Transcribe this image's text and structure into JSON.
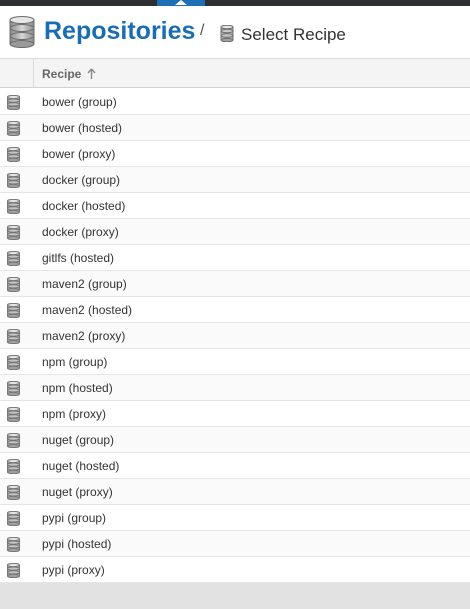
{
  "header": {
    "title": "Repositories",
    "separator": "/",
    "subtitle": "Select Recipe"
  },
  "grid": {
    "column_recipe": "Recipe",
    "sort": "ascending",
    "rows": [
      {
        "label": "bower (group)"
      },
      {
        "label": "bower (hosted)"
      },
      {
        "label": "bower (proxy)"
      },
      {
        "label": "docker (group)"
      },
      {
        "label": "docker (hosted)"
      },
      {
        "label": "docker (proxy)"
      },
      {
        "label": "gitlfs (hosted)"
      },
      {
        "label": "maven2 (group)"
      },
      {
        "label": "maven2 (hosted)"
      },
      {
        "label": "maven2 (proxy)"
      },
      {
        "label": "npm (group)"
      },
      {
        "label": "npm (hosted)"
      },
      {
        "label": "npm (proxy)"
      },
      {
        "label": "nuget (group)"
      },
      {
        "label": "nuget (hosted)"
      },
      {
        "label": "nuget (proxy)"
      },
      {
        "label": "pypi (group)"
      },
      {
        "label": "pypi (hosted)"
      },
      {
        "label": "pypi (proxy)"
      }
    ]
  },
  "icons": {
    "header": "database-icon",
    "row": "database-icon",
    "sort": "arrow-up-icon"
  },
  "colors": {
    "accent": "#1b6db3",
    "topbar": "#2d2f33",
    "active_tab": "#1e6fb6"
  }
}
